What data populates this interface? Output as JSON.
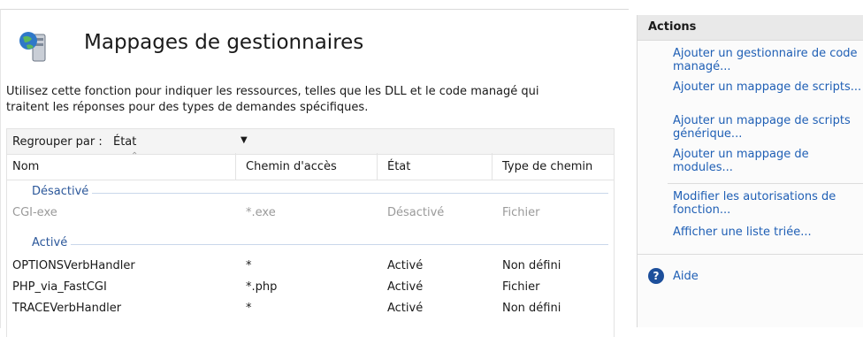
{
  "page": {
    "title": "Mappages de gestionnaires",
    "description_line1": "Utilisez cette fonction pour indiquer les ressources, telles que les DLL et le code managé qui",
    "description_line2": "traitent les réponses pour des types de demandes spécifiques.",
    "icon": "handler-mappings-icon"
  },
  "toolbar": {
    "group_by_label": "Regrouper par :",
    "group_by_value": "État"
  },
  "table": {
    "columns": [
      "Nom",
      "Chemin d'accès",
      "État",
      "Type de chemin"
    ],
    "groups": [
      {
        "label": "Désactivé",
        "rows": [
          [
            "CGI-exe",
            "*.exe",
            "Désactivé",
            "Fichier"
          ]
        ]
      },
      {
        "label": "Activé",
        "rows": [
          [
            "OPTIONSVerbHandler",
            "*",
            "Activé",
            "Non défini"
          ],
          [
            "PHP_via_FastCGI",
            "*.php",
            "Activé",
            "Fichier"
          ],
          [
            "TRACEVerbHandler",
            "*",
            "Activé",
            "Non défini"
          ]
        ]
      }
    ]
  },
  "actions": {
    "title": "Actions",
    "links": [
      "Ajouter un gestionnaire de code managé...",
      "Ajouter un mappage de scripts...",
      "Ajouter un mappage de scripts générique...",
      "Ajouter un mappage de modules...",
      "Modifier les autorisations de fonction...",
      "Afficher une liste triée..."
    ],
    "help_label": "Aide"
  }
}
